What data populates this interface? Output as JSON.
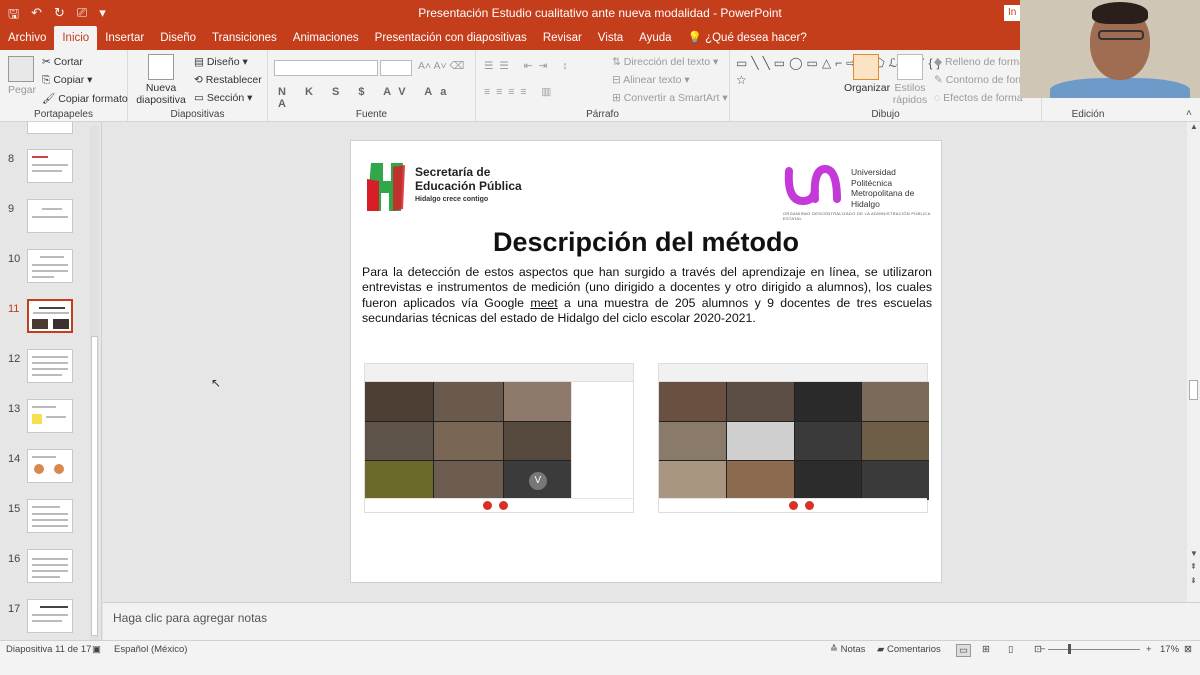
{
  "window": {
    "title": "Presentación Estudio cualitativo ante nueva modalidad  -  PowerPoint",
    "signin_stub": "In"
  },
  "qat": {
    "save": "🖫",
    "undo": "↶",
    "redo": "↻",
    "present": "⎚",
    "more": "▾"
  },
  "tabs": [
    {
      "label": "Archivo"
    },
    {
      "label": "Inicio",
      "active": true
    },
    {
      "label": "Insertar"
    },
    {
      "label": "Diseño"
    },
    {
      "label": "Transiciones"
    },
    {
      "label": "Animaciones"
    },
    {
      "label": "Presentación con diapositivas"
    },
    {
      "label": "Revisar"
    },
    {
      "label": "Vista"
    },
    {
      "label": "Ayuda"
    },
    {
      "label": "¿Qué desea hacer?"
    }
  ],
  "ribbon": {
    "clipboard": {
      "label": "Portapapeles",
      "paste": "Pegar",
      "cut": "Cortar",
      "copy": "Copiar",
      "format_painter": "Copiar formato"
    },
    "slides": {
      "label": "Diapositivas",
      "new_slide": "Nueva diapositiva",
      "layout": "Diseño",
      "reset": "Restablecer",
      "section": "Sección"
    },
    "font": {
      "label": "Fuente",
      "buttons": "N K S $ AV Aa A"
    },
    "paragraph": {
      "label": "Párrafo",
      "text_direction": "Dirección del texto",
      "align_text": "Alinear texto",
      "smartart": "Convertir a SmartArt"
    },
    "drawing": {
      "label": "Dibujo",
      "arrange": "Organizar",
      "quick_styles": "Estilos rápidos",
      "shape_fill": "Relleno de forma",
      "shape_outline": "Contorno de forma",
      "shape_effects": "Efectos de forma",
      "shapes_glyphs": "▭╲╲▭◯▭△⌐⇨⇩⬠ℒ╲⌒{}☆"
    },
    "editing": {
      "label": "Edición"
    }
  },
  "thumbnails": [
    {
      "num": "8"
    },
    {
      "num": "9"
    },
    {
      "num": "10"
    },
    {
      "num": "11",
      "selected": true
    },
    {
      "num": "12"
    },
    {
      "num": "13"
    },
    {
      "num": "14"
    },
    {
      "num": "15"
    },
    {
      "num": "16"
    },
    {
      "num": "17"
    }
  ],
  "slide": {
    "seph_line1": "Secretaría de",
    "seph_line2": "Educación Pública",
    "seph_tagline": "Hidalgo crece contigo",
    "upmh_line1": "Universidad",
    "upmh_line2": "Politécnica",
    "upmh_line3": "Metropolitana de",
    "upmh_line4": "Hidalgo",
    "upmh_sub": "ORGANISMO DESCENTRALIZADO DE LA ADMINISTRACIÓN PÚBLICA ESTATAL",
    "title": "Descripción del método",
    "body_before": "Para la detección de estos aspectos que han surgido a través del aprendizaje en línea, se utilizaron entrevistas e instrumentos de medición (uno dirigido a docentes y otro dirigido a alumnos), los cuales fueron aplicados vía Google ",
    "body_link": "meet",
    "body_after": " a una muestra de 205 alumnos y 9 docentes de tres escuelas secundarias técnicas del estado de Hidalgo del ciclo escolar 2020-2021.",
    "shot1_avatar": "V"
  },
  "notes": {
    "placeholder": "Haga clic para agregar notas"
  },
  "status": {
    "slide_of": "Diapositiva 11 de 17",
    "language": "Español (México)",
    "notes": "Notas",
    "comments": "Comentarios",
    "zoom": "17%",
    "minus": "−",
    "plus": "+"
  }
}
